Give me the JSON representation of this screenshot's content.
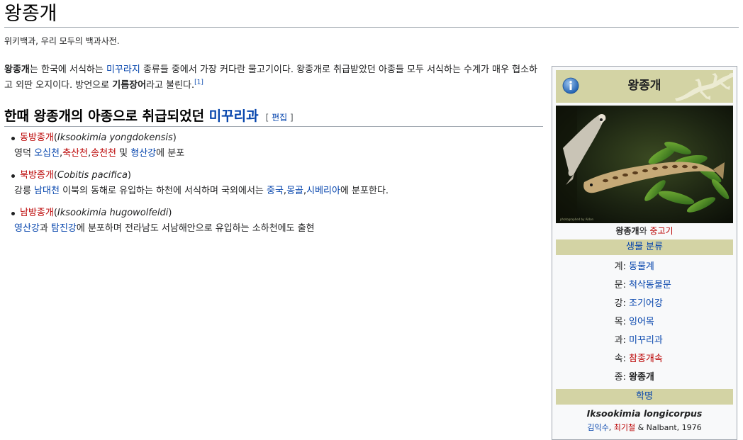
{
  "page": {
    "title": "왕종개",
    "tagline": "위키백과, 우리 모두의 백과사전."
  },
  "intro": {
    "bold1": "왕종개",
    "t1": "는 한국에 서식하는 ",
    "link1": "미꾸라지",
    "t2": " 종류들 중에서 가장 커다란 물고기이다. 왕종개로 취급받았던 아종들 모두 서식하는 수계가 매우 협소하고 외딴 오지이다. 방언으로 ",
    "bold2": "기름장어",
    "t3": "라고 불린다.",
    "ref": "[1]"
  },
  "section": {
    "heading_text": "한때 왕종개의 아종으로 취급되었던 ",
    "heading_link": "미꾸리과",
    "edit_open": "[ ",
    "edit_label": "편집",
    "edit_close": " ]"
  },
  "species": [
    {
      "name": "동방종개",
      "sci_open": "(",
      "sci": "Iksookimia yongdokensis",
      "sci_close": ")",
      "d1": "영덕 ",
      "l1": "오십천",
      "s1": ",",
      "l2": "축산천",
      "s2": ",",
      "l3": "송천천",
      "d2": " 및 ",
      "l4": "형산강",
      "d3": "에 분포"
    },
    {
      "name": "북방종개",
      "sci_open": "(",
      "sci": "Cobitis pacifica",
      "sci_close": ")",
      "d1": "강릉 ",
      "l1": "남대천",
      "d2": " 이북의 동해로 유입하는 하천에 서식하며 국외에서는 ",
      "l2": "중국",
      "s1": ",",
      "l3": "몽골",
      "s2": ",",
      "l4": "시베리아",
      "d3": "에 분포한다."
    },
    {
      "name": "남방종개",
      "sci_open": "(",
      "sci": "Iksookimia hugowolfeldi",
      "sci_close": ")",
      "l1": "영산강",
      "d1": "과 ",
      "l2": "탐진강",
      "d2": "에 분포하며 전라남도 서남해안으로 유입하는 소하천에도 출현"
    }
  ],
  "infobox": {
    "title": "왕종개",
    "photo_credit": "photographed by Aidon",
    "caption_bold": "왕종개",
    "caption_mid": "와 ",
    "caption_link": "중고기",
    "taxonomy_band": "생물 분류",
    "ranks": [
      {
        "rank": "계:",
        "value": "동물계"
      },
      {
        "rank": "문:",
        "value": "척삭동물문"
      },
      {
        "rank": "강:",
        "value": "조기어강"
      },
      {
        "rank": "목:",
        "value": "잉어목"
      },
      {
        "rank": "과:",
        "value": "미꾸리과"
      },
      {
        "rank": "속:",
        "value": "참종개속"
      },
      {
        "rank": "종:",
        "value": "왕종개"
      }
    ],
    "name_band": "학명",
    "sci_name": "Iksookimia longicorpus",
    "author1": "김익수",
    "author_sep": ", ",
    "author2": "최기철",
    "author_rest": " & Nalbant, 1976"
  },
  "colors": {
    "link": "#0645ad",
    "redlink": "#ba0000",
    "band": "#d3d3a4"
  },
  "icons": {
    "info": "info-circle-icon",
    "lizard": "lizard-silhouette-icon"
  }
}
